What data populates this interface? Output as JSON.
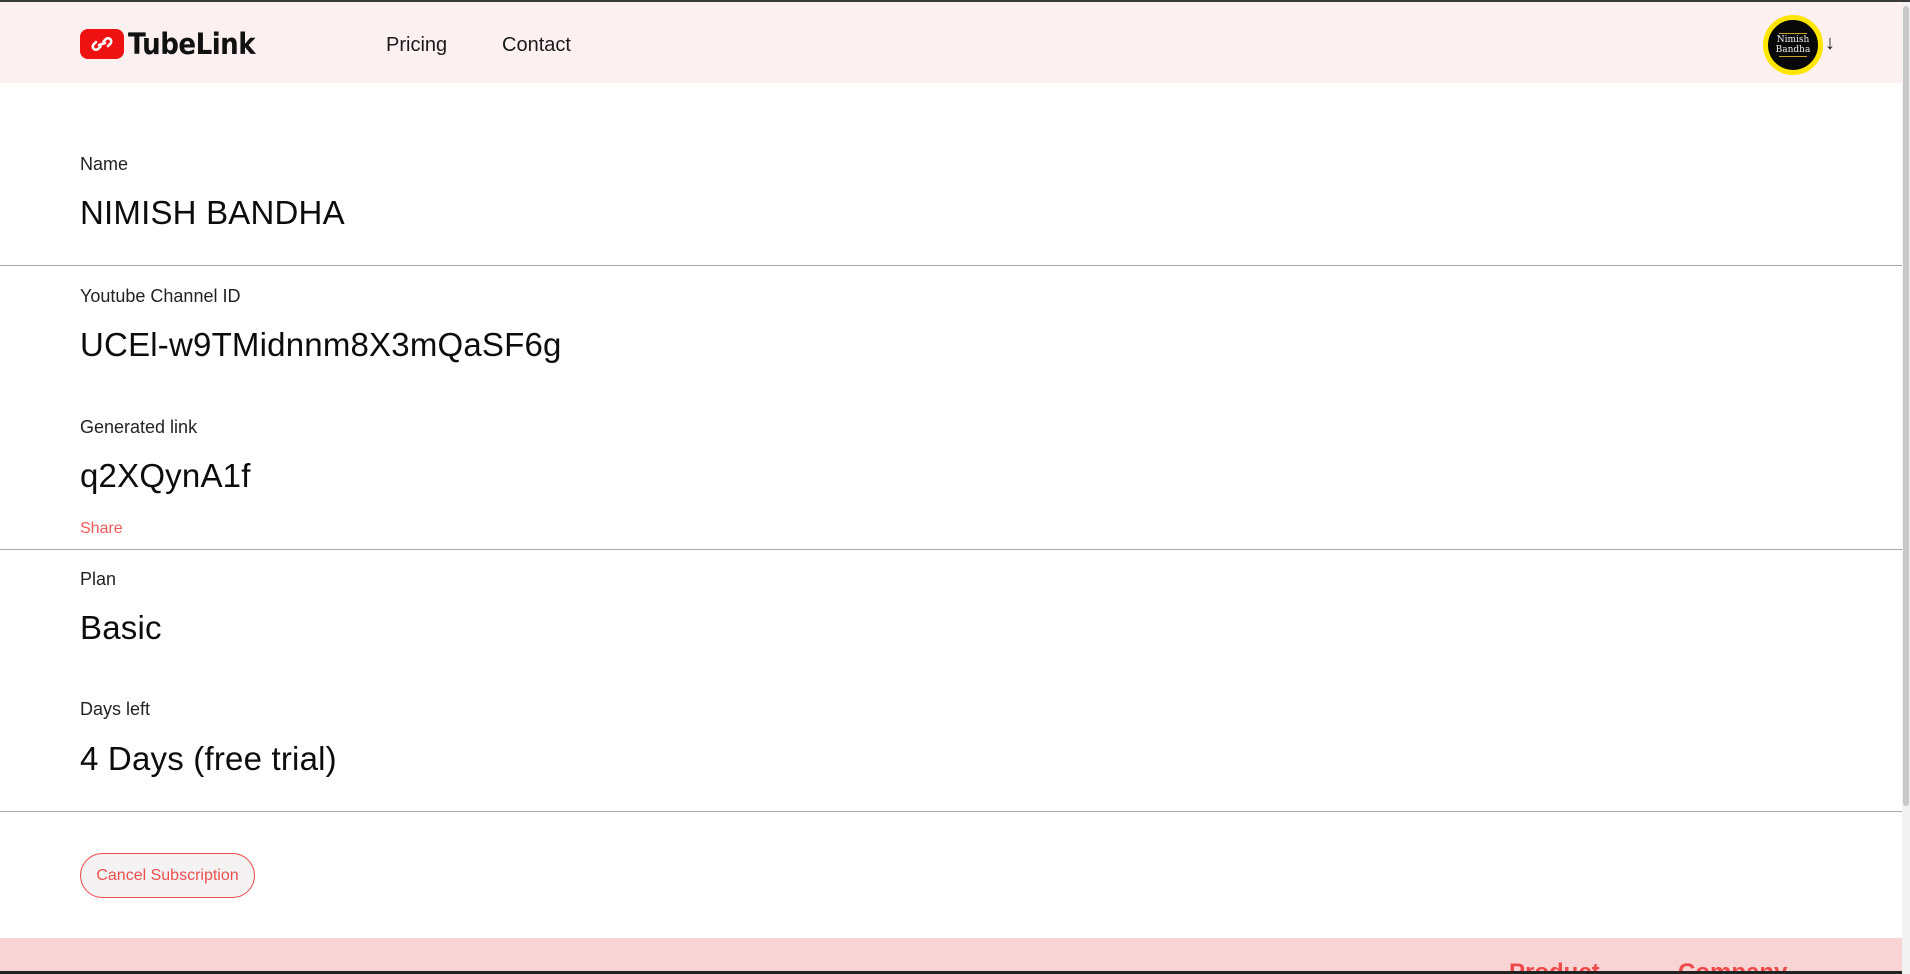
{
  "header": {
    "brand": "TubeLink",
    "nav": [
      {
        "label": "Pricing"
      },
      {
        "label": "Contact"
      }
    ],
    "avatar_text": "Nimish Bandha",
    "avatar_dropdown_glyph": "↓",
    "icons": [
      "link-icon",
      "avatar",
      "arrow-down-icon"
    ]
  },
  "profile": {
    "name_label": "Name",
    "name_value": "NIMISH BANDHA",
    "channel_label": "Youtube Channel ID",
    "channel_value": "UCEl-w9TMidnnm8X3mQaSF6g",
    "link_label": "Generated link",
    "link_value": "q2XQynA1f",
    "share_label": "Share",
    "plan_label": "Plan",
    "plan_value": "Basic",
    "days_label": "Days left",
    "days_value": "4 Days (free trial)",
    "cancel_label": "Cancel Subscription"
  },
  "footer": {
    "links": [
      {
        "label": "Product"
      },
      {
        "label": "Company"
      }
    ]
  },
  "colors": {
    "header_bg": "#fdf0f0",
    "footer_bg": "#f8d4d4",
    "accent": "#ec4f4f",
    "brand_red": "#ee1111",
    "avatar_ring": "#ffe600"
  }
}
